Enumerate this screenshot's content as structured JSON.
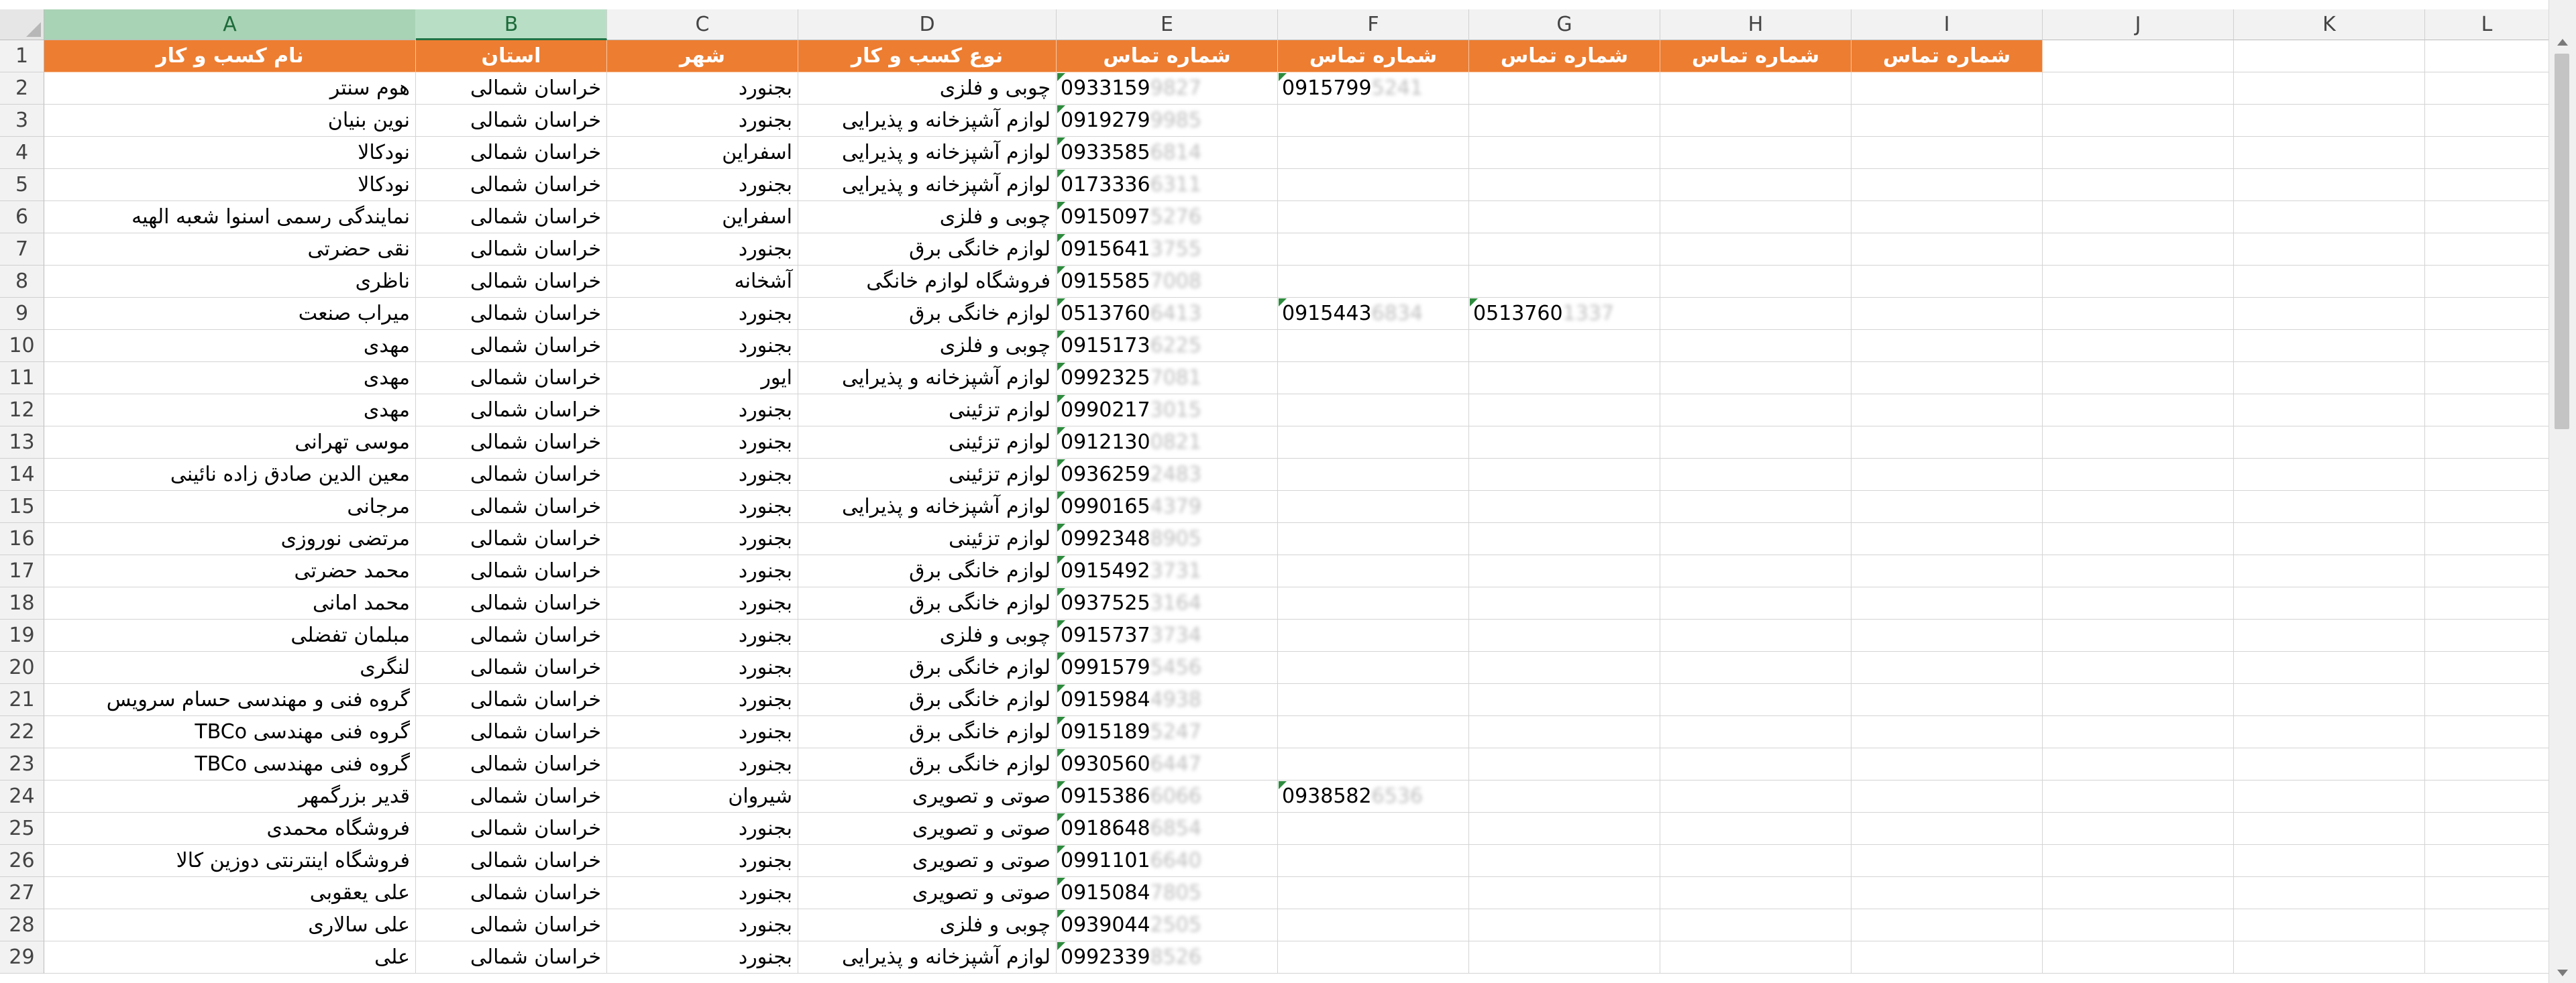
{
  "columns": [
    "A",
    "B",
    "C",
    "D",
    "E",
    "F",
    "G",
    "H",
    "I",
    "J",
    "K",
    "L"
  ],
  "header_row": {
    "row_num": "1",
    "cells": [
      "نام کسب و کار",
      "استان",
      "شهر",
      "نوع کسب و کار",
      "شماره تماس",
      "شماره تماس",
      "شماره تماس",
      "شماره تماس",
      "شماره تماس"
    ]
  },
  "rows": [
    {
      "n": "2",
      "name": "هوم سنتر",
      "province": "خراسان شمالی",
      "city": "بجنورد",
      "type": "چوبی و فلزی",
      "phone": "0933159",
      "phone_blur": "9827",
      "f": "0915799",
      "f_blur": "5241",
      "g": "",
      "g_blur": ""
    },
    {
      "n": "3",
      "name": "نوین بنیان",
      "province": "خراسان شمالی",
      "city": "بجنورد",
      "type": "لوازم آشپزخانه و پذیرایی",
      "phone": "0919279",
      "phone_blur": "9985",
      "f": "",
      "f_blur": "",
      "g": "",
      "g_blur": ""
    },
    {
      "n": "4",
      "name": "نودکالا",
      "province": "خراسان شمالی",
      "city": "اسفراین",
      "type": "لوازم آشپزخانه و پذیرایی",
      "phone": "0933585",
      "phone_blur": "6814",
      "f": "",
      "f_blur": "",
      "g": "",
      "g_blur": ""
    },
    {
      "n": "5",
      "name": "نودکالا",
      "province": "خراسان شمالی",
      "city": "بجنورد",
      "type": "لوازم آشپزخانه و پذیرایی",
      "phone": "0173336",
      "phone_blur": "6311",
      "f": "",
      "f_blur": "",
      "g": "",
      "g_blur": ""
    },
    {
      "n": "6",
      "name": "نمایندگی رسمی اسنوا شعبه الهیه",
      "province": "خراسان شمالی",
      "city": "اسفراین",
      "type": "چوبی و فلزی",
      "phone": "0915097",
      "phone_blur": "5276",
      "f": "",
      "f_blur": "",
      "g": "",
      "g_blur": ""
    },
    {
      "n": "7",
      "name": "نقی  حضرتی",
      "province": "خراسان شمالی",
      "city": "بجنورد",
      "type": "لوازم خانگی برق",
      "phone": "0915641",
      "phone_blur": "3755",
      "f": "",
      "f_blur": "",
      "g": "",
      "g_blur": ""
    },
    {
      "n": "8",
      "name": "ناظری",
      "province": "خراسان شمالی",
      "city": "آشخانه",
      "type": "فروشگاه لوازم خانگی",
      "phone": "0915585",
      "phone_blur": "7008",
      "f": "",
      "f_blur": "",
      "g": "",
      "g_blur": ""
    },
    {
      "n": "9",
      "name": "میراب صنعت",
      "province": "خراسان شمالی",
      "city": "بجنورد",
      "type": "لوازم خانگی برق",
      "phone": "0513760",
      "phone_blur": "6413",
      "f": "0915443",
      "f_blur": "6834",
      "g": "0513760",
      "g_blur": "1337"
    },
    {
      "n": "10",
      "name": "مهدی",
      "province": "خراسان شمالی",
      "city": "بجنورد",
      "type": "چوبی و فلزی",
      "phone": "0915173",
      "phone_blur": "6225",
      "f": "",
      "f_blur": "",
      "g": "",
      "g_blur": ""
    },
    {
      "n": "11",
      "name": "مهدی",
      "province": "خراسان شمالی",
      "city": "ایور",
      "type": "لوازم آشپزخانه و پذیرایی",
      "phone": "0992325",
      "phone_blur": "7081",
      "f": "",
      "f_blur": "",
      "g": "",
      "g_blur": ""
    },
    {
      "n": "12",
      "name": "مهدی",
      "province": "خراسان شمالی",
      "city": "بجنورد",
      "type": "لوازم تزئینی",
      "phone": "0990217",
      "phone_blur": "3015",
      "f": "",
      "f_blur": "",
      "g": "",
      "g_blur": ""
    },
    {
      "n": "13",
      "name": "موسی تهرانی",
      "province": "خراسان شمالی",
      "city": "بجنورد",
      "type": "لوازم تزئینی",
      "phone": "0912130",
      "phone_blur": "0821",
      "f": "",
      "f_blur": "",
      "g": "",
      "g_blur": ""
    },
    {
      "n": "14",
      "name": "معین الدین صادق زاده نائینی",
      "province": "خراسان شمالی",
      "city": "بجنورد",
      "type": "لوازم تزئینی",
      "phone": "0936259",
      "phone_blur": "2483",
      "f": "",
      "f_blur": "",
      "g": "",
      "g_blur": ""
    },
    {
      "n": "15",
      "name": "مرجانی",
      "province": "خراسان شمالی",
      "city": "بجنورد",
      "type": "لوازم آشپزخانه و پذیرایی",
      "phone": "0990165",
      "phone_blur": "4379",
      "f": "",
      "f_blur": "",
      "g": "",
      "g_blur": ""
    },
    {
      "n": "16",
      "name": "مرتضی نوروزی",
      "province": "خراسان شمالی",
      "city": "بجنورد",
      "type": "لوازم تزئینی",
      "phone": "0992348",
      "phone_blur": "8905",
      "f": "",
      "f_blur": "",
      "g": "",
      "g_blur": ""
    },
    {
      "n": "17",
      "name": "محمد حضرتی",
      "province": "خراسان شمالی",
      "city": "بجنورد",
      "type": "لوازم خانگی برق",
      "phone": "0915492",
      "phone_blur": "3731",
      "f": "",
      "f_blur": "",
      "g": "",
      "g_blur": ""
    },
    {
      "n": "18",
      "name": "محمد امانی",
      "province": "خراسان شمالی",
      "city": "بجنورد",
      "type": "لوازم خانگی برق",
      "phone": "0937525",
      "phone_blur": "3164",
      "f": "",
      "f_blur": "",
      "g": "",
      "g_blur": ""
    },
    {
      "n": "19",
      "name": "مبلمان تفضلی",
      "province": "خراسان شمالی",
      "city": "بجنورد",
      "type": "چوبی و فلزی",
      "phone": "0915737",
      "phone_blur": "3734",
      "f": "",
      "f_blur": "",
      "g": "",
      "g_blur": ""
    },
    {
      "n": "20",
      "name": "لنگری",
      "province": "خراسان شمالی",
      "city": "بجنورد",
      "type": "لوازم خانگی برق",
      "phone": "0991579",
      "phone_blur": "5456",
      "f": "",
      "f_blur": "",
      "g": "",
      "g_blur": ""
    },
    {
      "n": "21",
      "name": "گروه فنی و مهندسی حسام سرویس",
      "province": "خراسان شمالی",
      "city": "بجنورد",
      "type": "لوازم خانگی برق",
      "phone": "0915984",
      "phone_blur": "4938",
      "f": "",
      "f_blur": "",
      "g": "",
      "g_blur": ""
    },
    {
      "n": "22",
      "name": "گروه فنی مهندسی TBCo",
      "province": "خراسان شمالی",
      "city": "بجنورد",
      "type": "لوازم خانگی برق",
      "phone": "0915189",
      "phone_blur": "5247",
      "f": "",
      "f_blur": "",
      "g": "",
      "g_blur": ""
    },
    {
      "n": "23",
      "name": "گروه فنی مهندسی TBCo",
      "province": "خراسان شمالی",
      "city": "بجنورد",
      "type": "لوازم خانگی برق",
      "phone": "0930560",
      "phone_blur": "6447",
      "f": "",
      "f_blur": "",
      "g": "",
      "g_blur": ""
    },
    {
      "n": "24",
      "name": "قدیر بزرگمهر",
      "province": "خراسان شمالی",
      "city": "شیروان",
      "type": "صوتی و تصویری",
      "phone": "0915386",
      "phone_blur": "6066",
      "f": "0938582",
      "f_blur": "6536",
      "g": "",
      "g_blur": ""
    },
    {
      "n": "25",
      "name": "فروشگاه محمدی",
      "province": "خراسان شمالی",
      "city": "بجنورد",
      "type": "صوتی و تصویری",
      "phone": "0918648",
      "phone_blur": "6854",
      "f": "",
      "f_blur": "",
      "g": "",
      "g_blur": ""
    },
    {
      "n": "26",
      "name": "فروشگاه اینترنتی دوزین کالا",
      "province": "خراسان شمالی",
      "city": "بجنورد",
      "type": "صوتی و تصویری",
      "phone": "0991101",
      "phone_blur": "6640",
      "f": "",
      "f_blur": "",
      "g": "",
      "g_blur": ""
    },
    {
      "n": "27",
      "name": "علی یعقوبی",
      "province": "خراسان شمالی",
      "city": "بجنورد",
      "type": "صوتی و تصویری",
      "phone": "0915084",
      "phone_blur": "7805",
      "f": "",
      "f_blur": "",
      "g": "",
      "g_blur": ""
    },
    {
      "n": "28",
      "name": "علی سالاری",
      "province": "خراسان شمالی",
      "city": "بجنورد",
      "type": "چوبی و فلزی",
      "phone": "0939044",
      "phone_blur": "2505",
      "f": "",
      "f_blur": "",
      "g": "",
      "g_blur": ""
    },
    {
      "n": "29",
      "name": "علی",
      "province": "خراسان شمالی",
      "city": "بجنورد",
      "type": "لوازم آشپزخانه و پذیرایی",
      "phone": "0992339",
      "phone_blur": "8526",
      "f": "",
      "f_blur": "",
      "g": "",
      "g_blur": ""
    }
  ],
  "colors": {
    "header_fill": "#ed7d31",
    "header_text": "#ffffff",
    "selected_col": "#b8dfc5",
    "grid": "#d4d4d4"
  }
}
